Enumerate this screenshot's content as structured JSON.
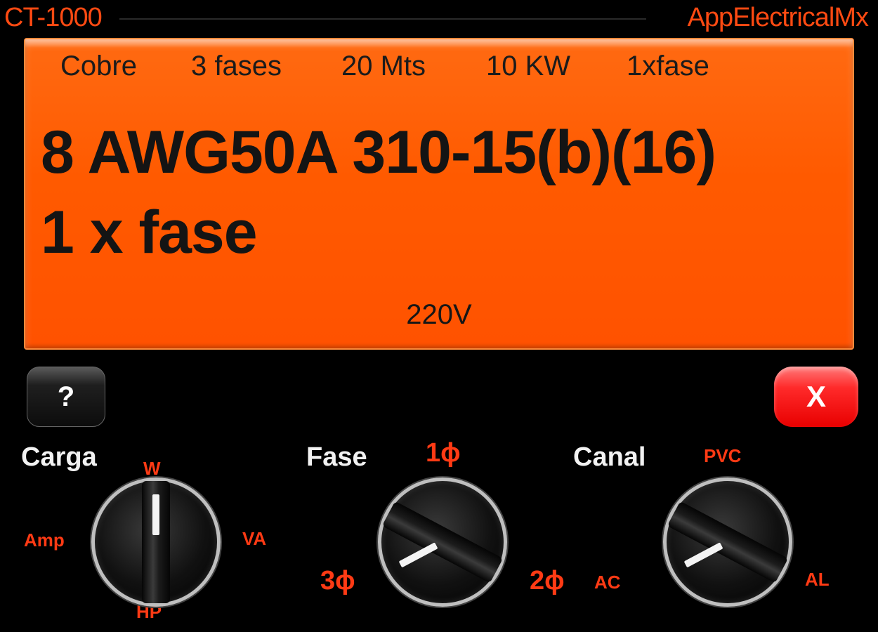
{
  "header": {
    "title": "CT-1000",
    "brand": "AppElectricalMx"
  },
  "display": {
    "specs": [
      "Cobre",
      "3 fases",
      "20 Mts",
      "10 KW",
      "1xfase"
    ],
    "result_line1": "8 AWG50A 310-15(b)(16)",
    "result_line2": "1 x fase",
    "voltage": "220V"
  },
  "buttons": {
    "help_label": "?",
    "close_label": "X"
  },
  "selectors": {
    "carga": {
      "label": "Carga",
      "positions": {
        "top": "W",
        "right": "VA",
        "bottom": "HP",
        "left": "Amp"
      },
      "selected": "W"
    },
    "fase": {
      "label": "Fase",
      "positions": {
        "top": "1ϕ",
        "right": "2ϕ",
        "left": "3ϕ"
      },
      "selected": "3ϕ"
    },
    "canal": {
      "label": "Canal",
      "positions": {
        "top": "PVC",
        "right": "AL",
        "left": "AC"
      },
      "selected": "AC"
    }
  },
  "colors": {
    "accent": "#ff4a12",
    "lcd": "#ff5a00",
    "close": "#ff1a1a"
  }
}
